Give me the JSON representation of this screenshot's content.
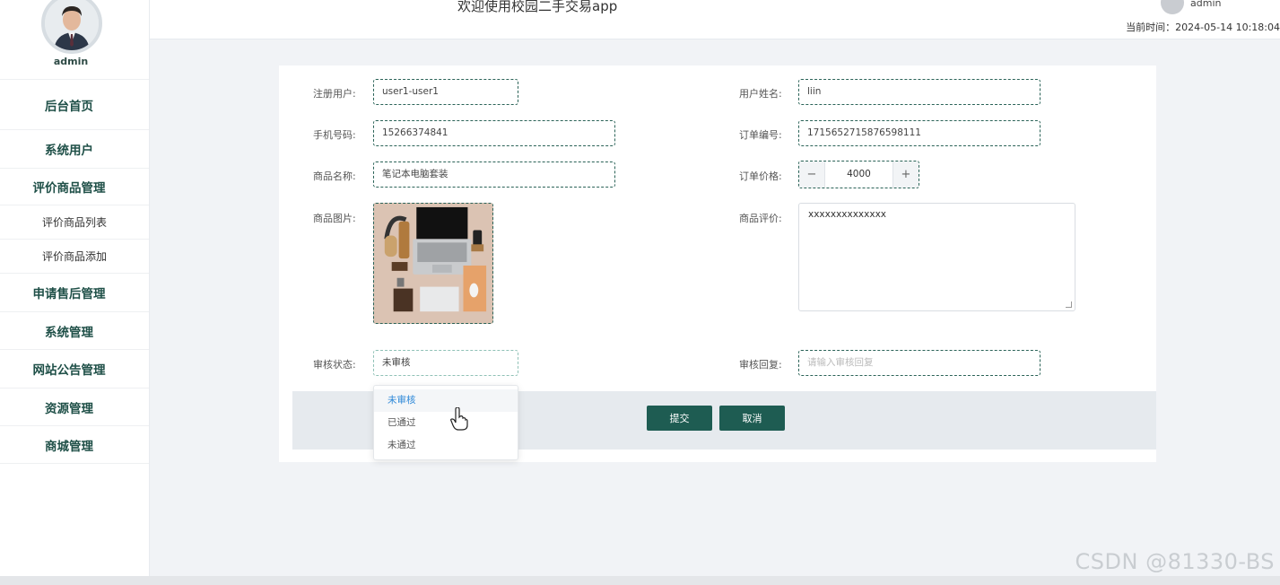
{
  "sidebar": {
    "username": "admin",
    "items": [
      {
        "label": "后台首页"
      },
      {
        "label": "系统用户"
      },
      {
        "label": "评价商品管理"
      },
      {
        "label": "评价商品列表"
      },
      {
        "label": "评价商品添加"
      },
      {
        "label": "申请售后管理"
      },
      {
        "label": "系统管理"
      },
      {
        "label": "网站公告管理"
      },
      {
        "label": "资源管理"
      },
      {
        "label": "商城管理"
      }
    ]
  },
  "header": {
    "title": "欢迎使用校园二手交易app",
    "user": "admin",
    "time_label": "当前时间：2024-05-14 10:18:04"
  },
  "form": {
    "user_label": "注册用户:",
    "user_value": "user1-user1",
    "name_label": "用户姓名:",
    "name_value": "liin",
    "phone_label": "手机号码:",
    "phone_value": "15266374841",
    "order_no_label": "订单编号:",
    "order_no_value": "1715652715876598111",
    "product_label": "商品名称:",
    "product_value": "笔记本电脑套装",
    "price_label": "订单价格:",
    "price_value": "4000",
    "minus": "−",
    "plus": "+",
    "image_label": "商品图片:",
    "review_label": "商品评价:",
    "review_value": "xxxxxxxxxxxxxx",
    "status_label": "审核状态:",
    "status_value": "未审核",
    "reply_label": "审核回复:",
    "reply_placeholder": "请输入审核回复",
    "submit": "提交",
    "cancel": "取消"
  },
  "dropdown": {
    "options": [
      "未审核",
      "已通过",
      "未通过"
    ],
    "highlighted": "未审核"
  },
  "watermark": "CSDN @81330-BS",
  "colors": {
    "accent": "#1e5c52",
    "dashed_border": "#2b6358",
    "menu_text": "#1e4f47",
    "option_active": "#2f89d8"
  }
}
